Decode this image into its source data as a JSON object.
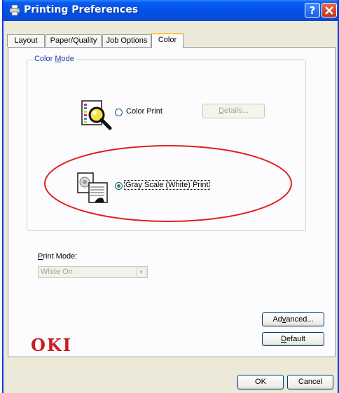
{
  "window": {
    "title": "Printing Preferences"
  },
  "colors": {
    "title_bar": "#0051e3",
    "tab_highlight": "#ffc83c",
    "brand": "#c81c22",
    "annotation": "#e02020",
    "radio_selected": "#21a121"
  },
  "icons": {
    "title": "printer-icon",
    "color_print": "color-document-magnifier-icon",
    "gray_print": "grayscale-document-icon"
  },
  "tabs": [
    {
      "label": "Layout",
      "active": false
    },
    {
      "label": "Paper/Quality",
      "active": false
    },
    {
      "label": "Job Options",
      "active": false
    },
    {
      "label": "Color",
      "active": true
    }
  ],
  "color_mode": {
    "group_label_prefix": "Color ",
    "group_label_accel": "M",
    "group_label_suffix": "ode",
    "options": [
      {
        "label": "Color Print",
        "selected": false
      },
      {
        "label": "Gray Scale (White) Print",
        "selected": true
      }
    ],
    "details_accel": "D",
    "details_rest": "etails..."
  },
  "print_mode": {
    "label_accel": "P",
    "label_rest": "rint Mode:",
    "value": "White On"
  },
  "buttons": {
    "advanced_pre": "Ad",
    "advanced_accel": "v",
    "advanced_post": "anced...",
    "default_accel": "D",
    "default_rest": "efault",
    "ok": "OK",
    "cancel": "Cancel"
  },
  "brand": "OKI"
}
